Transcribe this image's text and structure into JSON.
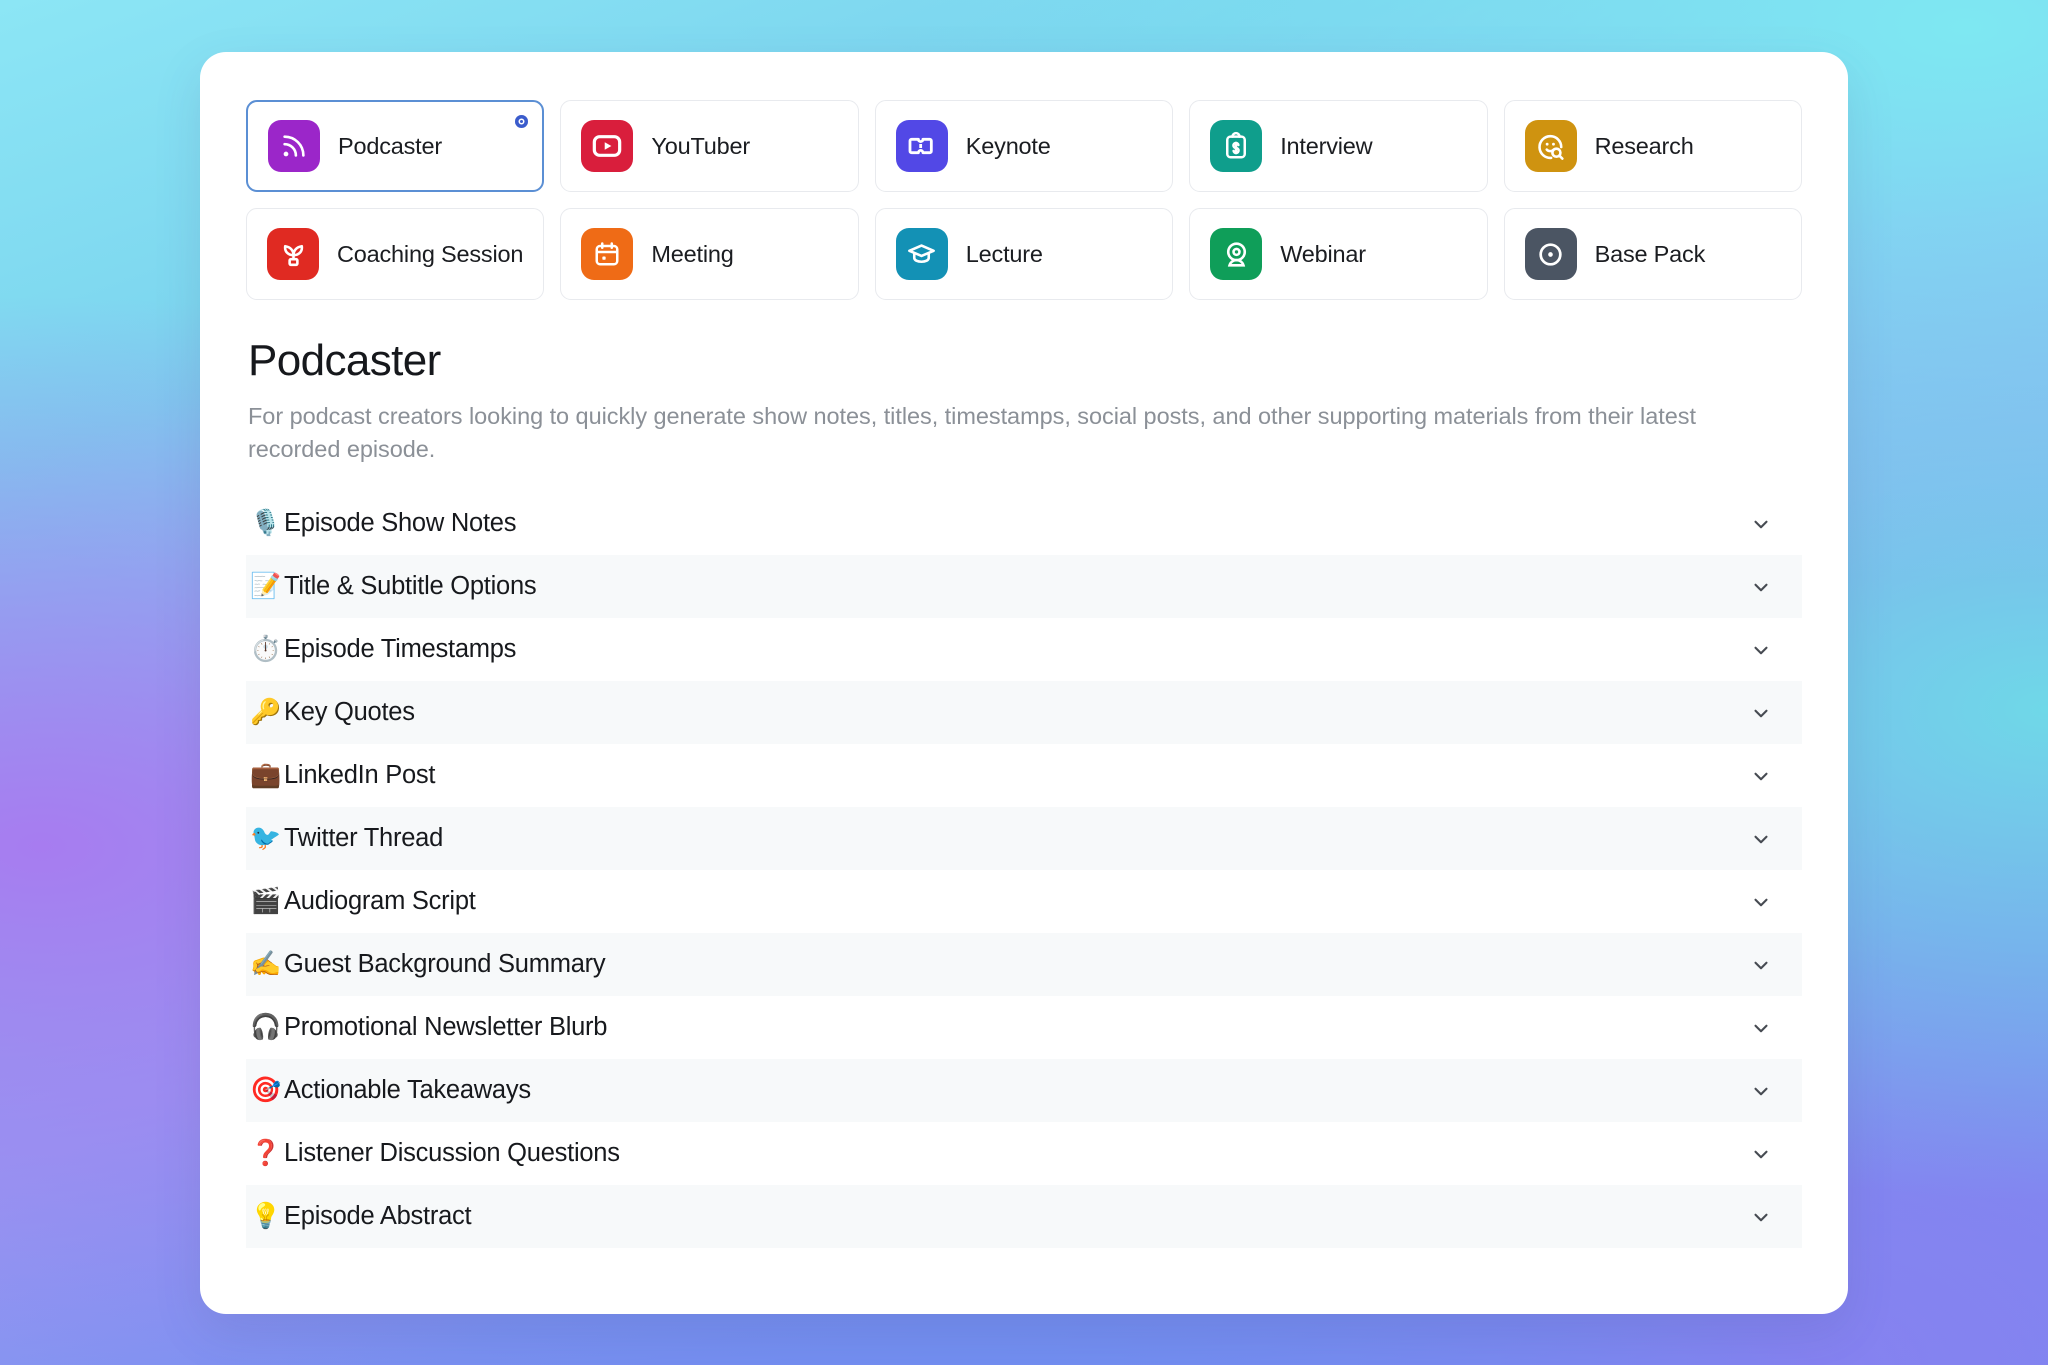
{
  "theme": {
    "accent": "#3b5ccc",
    "selected_border": "#5b8fd4",
    "card_bg": "#ffffff",
    "row_alt_bg": "#f7f9fa",
    "title_color": "#16181c",
    "desc_color": "#8b9097"
  },
  "templates": [
    {
      "label": "Podcaster",
      "icon": "rss-podcast-icon",
      "color": "#9b26c9",
      "selected": true,
      "indicator": "selected-dot"
    },
    {
      "label": "YouTuber",
      "icon": "youtube-play-icon",
      "color": "#d91e3c",
      "selected": false,
      "indicator": ""
    },
    {
      "label": "Keynote",
      "icon": "ticket-icon",
      "color": "#5248e6",
      "selected": false,
      "indicator": ""
    },
    {
      "label": "Interview",
      "icon": "clipboard-cash-icon",
      "color": "#0f9e8c",
      "selected": false,
      "indicator": ""
    },
    {
      "label": "Research",
      "icon": "face-search-icon",
      "color": "#cf9310",
      "selected": false,
      "indicator": ""
    },
    {
      "label": "Coaching Session",
      "icon": "sprout-plant-icon",
      "color": "#e02a22",
      "selected": false,
      "indicator": ""
    },
    {
      "label": "Meeting",
      "icon": "calendar-icon",
      "color": "#ef6b16",
      "selected": false,
      "indicator": ""
    },
    {
      "label": "Lecture",
      "icon": "graduation-cap-icon",
      "color": "#1391b5",
      "selected": false,
      "indicator": ""
    },
    {
      "label": "Webinar",
      "icon": "webcam-icon",
      "color": "#0f9e59",
      "selected": false,
      "indicator": ""
    },
    {
      "label": "Base Pack",
      "icon": "target-circle-icon",
      "color": "#4b5563",
      "selected": false,
      "indicator": ""
    }
  ],
  "detail": {
    "title": "Podcaster",
    "description": "For podcast creators looking to quickly generate show notes, titles, timestamps, social posts, and other supporting materials from their latest recorded episode."
  },
  "sections": [
    {
      "emoji": "🎙️",
      "emoji_name": "studio-microphone-emoji",
      "label": "Episode Show Notes",
      "expanded": false,
      "chevron": "chevron-down-icon"
    },
    {
      "emoji": "📝",
      "emoji_name": "memo-emoji",
      "label": "Title & Subtitle Options",
      "expanded": false,
      "chevron": "chevron-down-icon"
    },
    {
      "emoji": "⏱️",
      "emoji_name": "stopwatch-emoji",
      "label": "Episode Timestamps",
      "expanded": false,
      "chevron": "chevron-down-icon"
    },
    {
      "emoji": "🔑",
      "emoji_name": "key-emoji",
      "label": "Key Quotes",
      "expanded": false,
      "chevron": "chevron-down-icon"
    },
    {
      "emoji": "💼",
      "emoji_name": "briefcase-emoji",
      "label": "LinkedIn Post",
      "expanded": false,
      "chevron": "chevron-down-icon"
    },
    {
      "emoji": "🐦",
      "emoji_name": "bird-emoji",
      "label": "Twitter Thread",
      "expanded": false,
      "chevron": "chevron-down-icon"
    },
    {
      "emoji": "🎬",
      "emoji_name": "clapper-board-emoji",
      "label": "Audiogram Script",
      "expanded": false,
      "chevron": "chevron-down-icon"
    },
    {
      "emoji": "✍️",
      "emoji_name": "writing-hand-emoji",
      "label": "Guest Background Summary",
      "expanded": false,
      "chevron": "chevron-down-icon"
    },
    {
      "emoji": "🎧",
      "emoji_name": "headphone-emoji",
      "label": "Promotional Newsletter Blurb",
      "expanded": false,
      "chevron": "chevron-down-icon"
    },
    {
      "emoji": "🎯",
      "emoji_name": "direct-hit-emoji",
      "label": "Actionable Takeaways",
      "expanded": false,
      "chevron": "chevron-down-icon"
    },
    {
      "emoji": "❓",
      "emoji_name": "red-question-mark-emoji",
      "label": "Listener Discussion Questions",
      "expanded": false,
      "chevron": "chevron-down-icon"
    },
    {
      "emoji": "💡",
      "emoji_name": "light-bulb-emoji",
      "label": "Episode Abstract",
      "expanded": false,
      "chevron": "chevron-down-icon"
    }
  ]
}
